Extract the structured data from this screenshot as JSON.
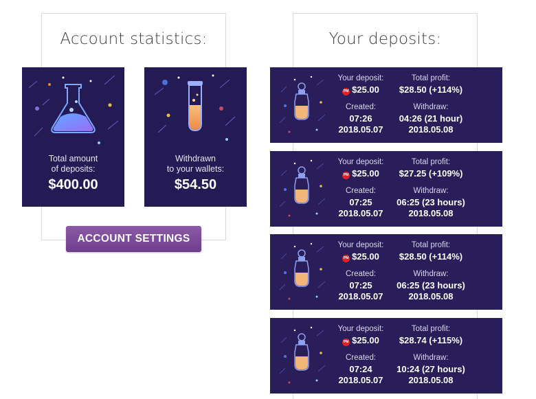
{
  "stats": {
    "title": "Account statistics:",
    "cards": [
      {
        "label_line1": "Total amount",
        "label_line2": "of deposits:",
        "amount": "$400.00",
        "icon": "flask-icon"
      },
      {
        "label_line1": "Withdrawn",
        "label_line2": "to your wallets:",
        "amount": "$54.50",
        "icon": "test-tube-icon"
      }
    ],
    "settings_button": "ACCOUNT SETTINGS"
  },
  "deposits": {
    "title": "Your deposits:",
    "labels": {
      "deposit": "Your deposit:",
      "profit": "Total profit:",
      "created": "Created:",
      "withdraw": "Withdraw:"
    },
    "payment_badge": "PM",
    "items": [
      {
        "amount": "$25.00",
        "profit": "$28.50 (+114%)",
        "created_time": "07:26",
        "created_date": "2018.05.07",
        "withdraw_time": "04:26 (21 hour)",
        "withdraw_date": "2018.05.08"
      },
      {
        "amount": "$25.00",
        "profit": "$27.25 (+109%)",
        "created_time": "07:25",
        "created_date": "2018.05.07",
        "withdraw_time": "06:25 (23 hours)",
        "withdraw_date": "2018.05.08"
      },
      {
        "amount": "$25.00",
        "profit": "$28.50 (+114%)",
        "created_time": "07:25",
        "created_date": "2018.05.07",
        "withdraw_time": "06:25 (23 hours)",
        "withdraw_date": "2018.05.08"
      },
      {
        "amount": "$25.00",
        "profit": "$28.74 (+115%)",
        "created_time": "07:24",
        "created_date": "2018.05.07",
        "withdraw_time": "10:24 (27 hours)",
        "withdraw_date": "2018.05.08"
      }
    ]
  },
  "colors": {
    "card_bg": "#241a54",
    "deposit_bg": "#2a1e5a",
    "button": "#7b4a9a",
    "pm_badge": "#e12028"
  }
}
